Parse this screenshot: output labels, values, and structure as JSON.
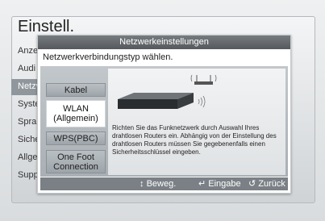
{
  "settings": {
    "title": "Einstell.",
    "menu": [
      "Anze",
      "Audi",
      "Netzv",
      "Syste",
      "Spra",
      "Siche",
      "Allge",
      "Supp"
    ],
    "active_index": 2
  },
  "dialog": {
    "title": "Netzwerkeinstellungen",
    "subtitle": "Netzwerkverbindungstyp wählen.",
    "options": {
      "kabel": "Kabel",
      "wlan_line1": "WLAN",
      "wlan_line2": "(Allgemein)",
      "wps": "WPS(PBC)",
      "onefoot_line1": "One Foot",
      "onefoot_line2": "Connection"
    },
    "selected_option": "WLAN (Allgemein)",
    "description": "Richten Sie das Funknetzwerk durch Auswahl Ihres drahtlosen Routers ein. Abhängig von der Einstellung des drahtlosen Routers müssen Sie gegebenenfalls einen Sicherheitsschlüssel eingeben."
  },
  "footer": {
    "move_icon": "up-down-arrows-icon",
    "move_label": "Beweg.",
    "enter_icon": "enter-icon",
    "enter_label": "Eingabe",
    "back_icon": "return-icon",
    "back_label": "Zurück"
  }
}
